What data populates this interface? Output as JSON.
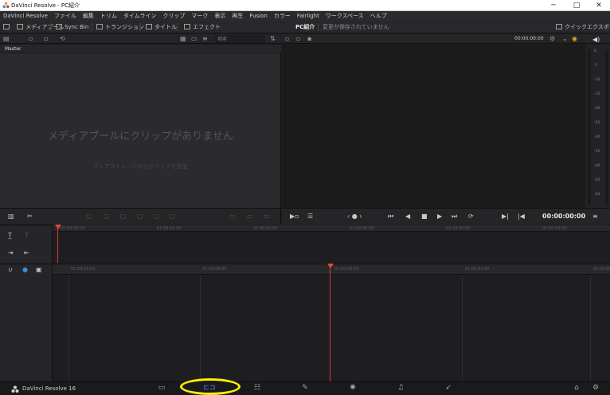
{
  "window": {
    "title": "DaVinci Resolve - PC紹介",
    "minimize": "─",
    "maximize": "□",
    "close": "✕"
  },
  "menu": [
    "DaVinci Resolve",
    "ファイル",
    "編集",
    "トリム",
    "タイムライン",
    "クリップ",
    "マーク",
    "表示",
    "再生",
    "Fusion",
    "カラー",
    "Fairlight",
    "ワークスペース",
    "ヘルプ"
  ],
  "toolbar": {
    "media_pool": "メディアプール",
    "sync_bin": "Sync Bin",
    "transitions": "トランジション",
    "titles": "タイトル",
    "effects": "エフェクト",
    "project_name": "PC紹介",
    "save_status": "変更が保存されていません",
    "quick_export": "クイックエクスポート"
  },
  "media_pool": {
    "search_placeholder": "検索",
    "bin_name": "Master",
    "empty_title": "メディアプールにクリップがありません",
    "empty_hint": "ディアストレージからクリップを追加"
  },
  "viewer": {
    "header_timecode": "00:00:00:00",
    "playback_timecode": "00:00:00:00",
    "meter_ticks": [
      "0",
      "-5",
      "-10",
      "-15",
      "-20",
      "-25",
      "-30",
      "-35",
      "-40",
      "-45",
      "-50"
    ]
  },
  "timeline": {
    "upper_ruler": [
      "01:00:00:00",
      "01:00:10:00",
      "01:00:20:00",
      "01:00:30:00",
      "01:00:40:00",
      "01:00:50:00"
    ],
    "lower_ruler": [
      "01:59:55:00",
      "01:59:58:00",
      "01:00:00:00",
      "01:00:03:00",
      "01:00:06:00"
    ]
  },
  "bottom": {
    "app_name": "DaVinci Resolve 16"
  },
  "colors": {
    "accent_playhead": "#d23b2f",
    "highlight_ring": "#ffee00",
    "panel_bg": "#2b2b2e"
  },
  "icons": [
    "davinci-logo-icon",
    "media-page-icon",
    "cut-page-icon",
    "edit-page-icon",
    "fusion-page-icon",
    "color-page-icon",
    "fairlight-page-icon",
    "deliver-page-icon",
    "home-icon",
    "settings-icon"
  ]
}
